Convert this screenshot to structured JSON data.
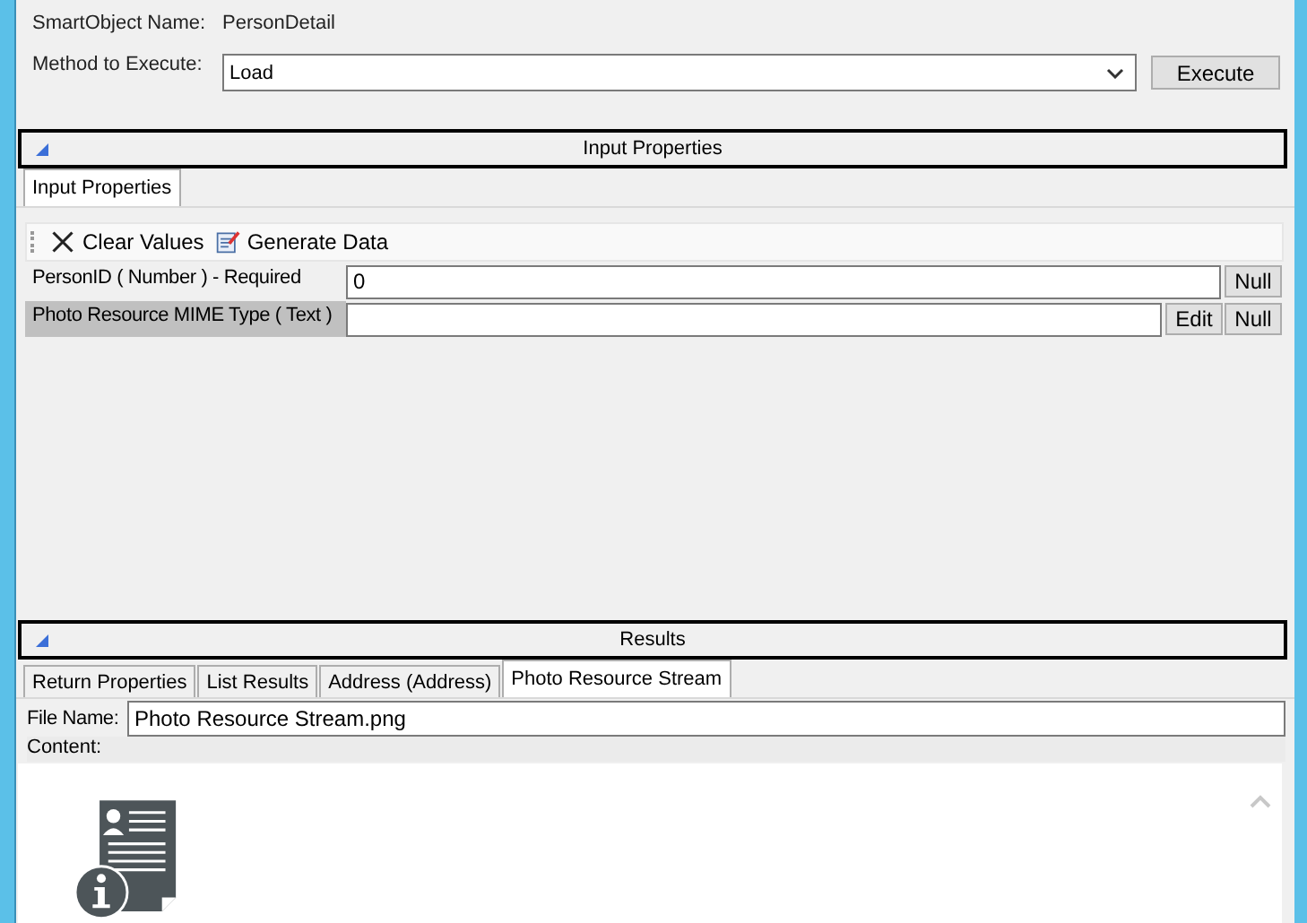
{
  "header": {
    "smartobject_label": "SmartObject Name:",
    "smartobject_value": "PersonDetail",
    "method_label": "Method to Execute:",
    "method_value": "Load",
    "execute_button": "Execute"
  },
  "input_section": {
    "title": "Input Properties",
    "tabs": [
      {
        "label": "Input Properties",
        "selected": true
      }
    ],
    "toolbar": [
      {
        "label": "Clear Values",
        "kind": "clear"
      },
      {
        "label": "Generate Data",
        "kind": "generate"
      }
    ],
    "rows": [
      {
        "label": "PersonID ( Number )  - Required",
        "value": "0",
        "selected": false,
        "buttons": [
          "Null"
        ]
      },
      {
        "label": "Photo Resource MIME Type ( Text )",
        "selected": true,
        "buttons": [
          "Edit",
          "Null"
        ]
      }
    ]
  },
  "results_section": {
    "title": "Results",
    "tabs": [
      {
        "label": "Return Properties",
        "selected": false
      },
      {
        "label": "List Results",
        "selected": false
      },
      {
        "label": "Address (Address)",
        "selected": false
      },
      {
        "label": "Photo Resource Stream",
        "selected": true
      }
    ],
    "file_name_label": "File Name:",
    "file_name_value": "Photo Resource Stream.png",
    "content_label": "Content:"
  }
}
